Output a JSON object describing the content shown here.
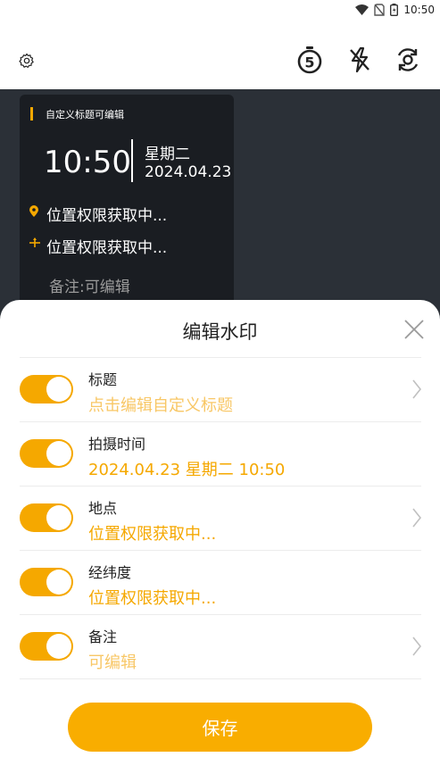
{
  "status_bar": {
    "time": "10:50"
  },
  "watermark": {
    "title": "自定义标题可编辑",
    "time": "10:50",
    "weekday": "星期二",
    "date": "2024.04.23",
    "location": "位置权限获取中...",
    "coordinates": "位置权限获取中...",
    "note": "备注:可编辑"
  },
  "sheet": {
    "title": "编辑水印",
    "rows": [
      {
        "label": "标题",
        "value": "点击编辑自定义标题",
        "enabled": true,
        "has_chevron": true
      },
      {
        "label": "拍摄时间",
        "value": "2024.04.23 星期二 10:50",
        "enabled": true,
        "has_chevron": false
      },
      {
        "label": "地点",
        "value": "位置权限获取中...",
        "enabled": true,
        "has_chevron": true
      },
      {
        "label": "经纬度",
        "value": "位置权限获取中...",
        "enabled": true,
        "has_chevron": false
      },
      {
        "label": "备注",
        "value": "可编辑",
        "enabled": true,
        "has_chevron": true
      }
    ],
    "save_label": "保存"
  },
  "colors": {
    "accent": "#f5a800",
    "camera_bg": "#2b3037",
    "card_bg": "#1a1d22"
  }
}
